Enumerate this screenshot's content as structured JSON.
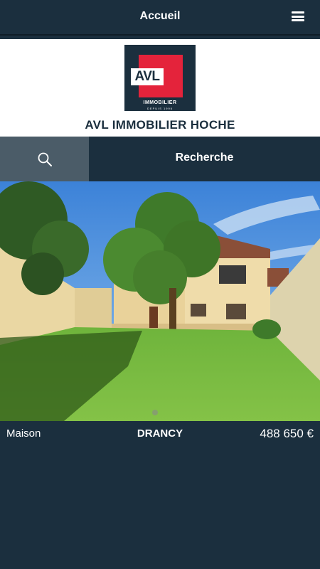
{
  "header": {
    "title": "Accueil",
    "menu_icon": "hamburger-menu-icon"
  },
  "agency": {
    "logo_text": "AVL",
    "logo_subtitle": "IMMOBILIER",
    "logo_tagline": "DEPUIS 1996",
    "name": "AVL IMMOBILIER HOCHE"
  },
  "search": {
    "icon": "search-icon",
    "button_label": "Recherche"
  },
  "listing": {
    "type": "Maison",
    "city": "DRANCY",
    "price": "488 650 €"
  },
  "colors": {
    "navy": "#1b2f3e",
    "search_bg": "#4b5c68",
    "logo_red": "#e4233b"
  }
}
